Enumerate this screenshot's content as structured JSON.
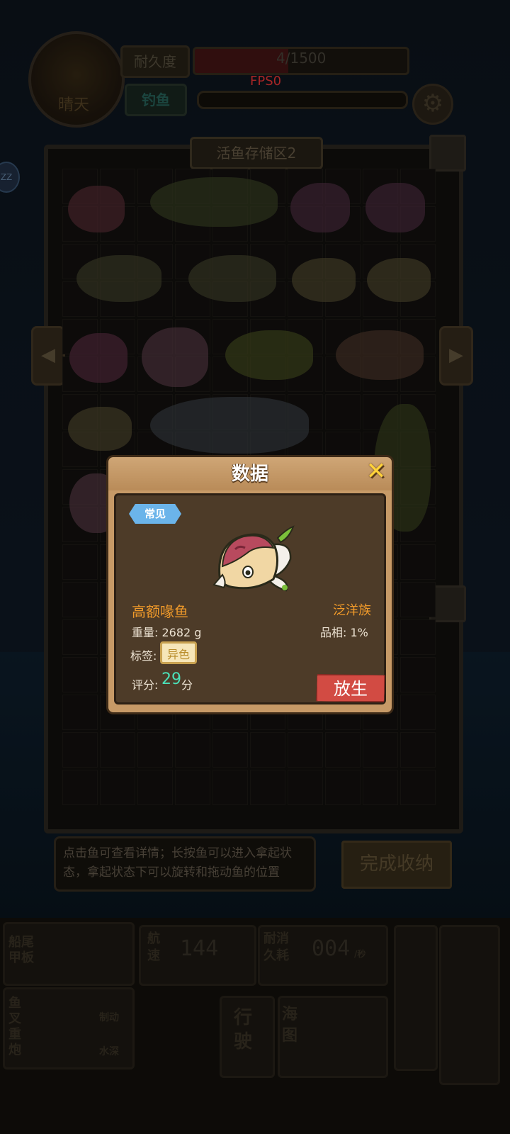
{
  "hud": {
    "weather_label": "晴天",
    "durability_label": "耐久度",
    "durability_text": "4/1500",
    "durability_fraction": 0.44,
    "fishing_label": "钓鱼",
    "fps": "FPS0",
    "side_badge": "ZZ"
  },
  "storage": {
    "title": "活鱼存储区2",
    "prev_icon": "◀",
    "next_icon": "▶"
  },
  "hint": {
    "text": "点击鱼可查看详情；长按鱼可以进入拿起状态，拿起状态下可以旋转和拖动鱼的位置"
  },
  "finish_label": "完成收纳",
  "console": {
    "speed_label": "航速",
    "speed_value": "144",
    "consume_label": "耐消久耗",
    "consume_value": "004",
    "consume_unit": "/秒",
    "drive_label": "行驶",
    "map_label": "海图",
    "deck_label": "船尾甲板",
    "harpoon_label": "鱼叉重炮",
    "brake_label": "制动",
    "depth_label": "水深"
  },
  "modal": {
    "title": "数据",
    "rarity": "常见",
    "fish_name": "高额喙鱼",
    "family": "泛洋族",
    "weight_label": "重量: 2682 g",
    "quality_label": "品相: 1%",
    "tag_label": "标签:",
    "tag_value": "异色",
    "score_label": "评分:",
    "score_value": "29",
    "score_unit": "分",
    "release_label": "放生",
    "colors": {
      "fish_head": "#b84a5e",
      "fish_body": "#f1d7a4",
      "accent_orange": "#f09a2a",
      "score_teal": "#4be0b8",
      "release_red": "#d24b43",
      "rarity_blue": "#6bb4ea"
    }
  }
}
